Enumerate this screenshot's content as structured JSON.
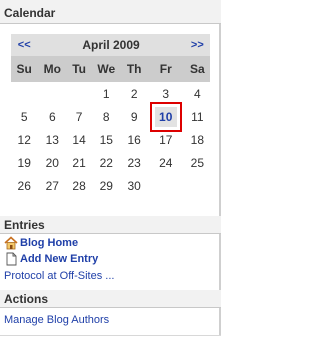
{
  "calendar": {
    "header": "Calendar",
    "prev_label": "<<",
    "next_label": ">>",
    "month_title": "April 2009",
    "weekdays": [
      "Su",
      "Mo",
      "Tu",
      "We",
      "Th",
      "Fr",
      "Sa"
    ],
    "weeks": [
      [
        "",
        "",
        "",
        "1",
        "2",
        "3",
        "4"
      ],
      [
        "5",
        "6",
        "7",
        "8",
        "9",
        "10",
        "11"
      ],
      [
        "12",
        "13",
        "14",
        "15",
        "16",
        "17",
        "18"
      ],
      [
        "19",
        "20",
        "21",
        "22",
        "23",
        "24",
        "25"
      ],
      [
        "26",
        "27",
        "28",
        "29",
        "30",
        "",
        ""
      ]
    ],
    "selected_day": "10"
  },
  "entries": {
    "header": "Entries",
    "blog_home": "Blog Home",
    "add_new_entry": "Add New Entry",
    "protocol": "Protocol at Off-Sites ..."
  },
  "actions": {
    "header": "Actions",
    "manage_authors": "Manage Blog Authors"
  },
  "colors": {
    "link": "#1f3fa8",
    "selected_outline": "#dd0000",
    "weekday_bg": "#cccccc",
    "nav_bg": "#e0e0e0"
  }
}
